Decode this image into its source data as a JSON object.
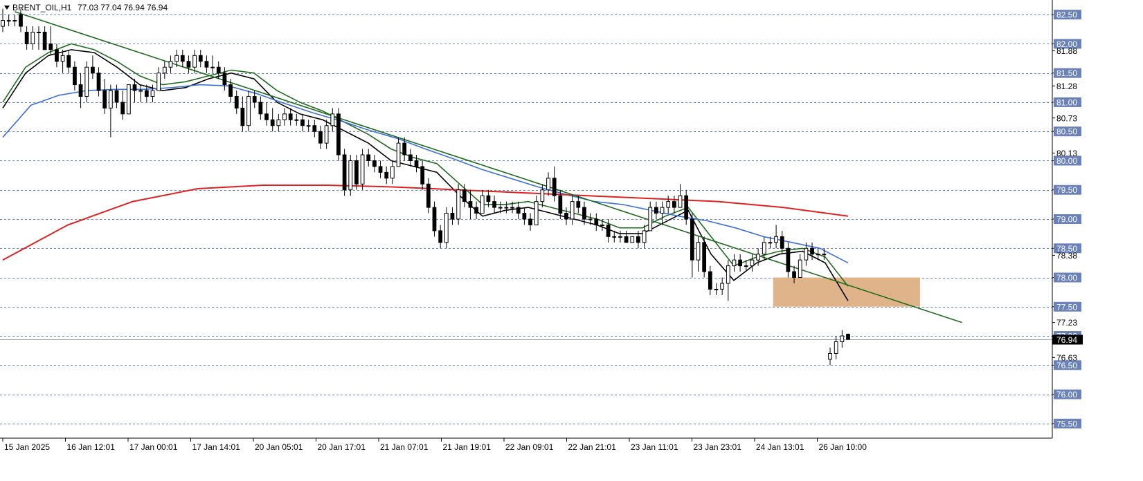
{
  "header": {
    "symbol": "BRENT_OIL,H1",
    "ohlc": "77.03 77.04 76.94 76.94"
  },
  "chart_data": {
    "type": "candlestick",
    "symbol": "BRENT_OIL",
    "timeframe": "H1",
    "ylim": [
      75.25,
      82.75
    ],
    "grid": true,
    "price_labels": [
      "82.50",
      "82.00",
      "81.88",
      "81.50",
      "81.28",
      "81.00",
      "80.73",
      "80.50",
      "80.13",
      "80.00",
      "79.50",
      "79.00",
      "78.50",
      "78.38",
      "78.00",
      "77.50",
      "77.23",
      "77.00",
      "76.63",
      "76.50",
      "76.00",
      "75.50"
    ],
    "highlight_labels": [
      "82.50",
      "82.00",
      "81.50",
      "81.00",
      "80.50",
      "80.00",
      "79.50",
      "79.00",
      "78.50",
      "78.00",
      "77.50",
      "77.00",
      "76.50",
      "76.00",
      "75.50"
    ],
    "current_price": 76.94,
    "current_price_label": "76.94",
    "time_labels": [
      "15 Jan 2025",
      "16 Jan 12:01",
      "17 Jan 00:01",
      "17 Jan 14:01",
      "20 Jan 05:01",
      "20 Jan 17:01",
      "21 Jan 07:01",
      "21 Jan 19:01",
      "22 Jan 09:01",
      "22 Jan 21:01",
      "23 Jan 11:01",
      "23 Jan 23:01",
      "24 Jan 13:01",
      "26 Jan 10:00"
    ],
    "candles": [
      [
        82.3,
        82.6,
        82.2,
        82.4
      ],
      [
        82.4,
        82.5,
        82.3,
        82.4
      ],
      [
        82.4,
        82.5,
        82.3,
        82.4
      ],
      [
        82.5,
        82.6,
        82.2,
        82.3
      ],
      [
        82.2,
        82.3,
        81.9,
        82.0
      ],
      [
        82.0,
        82.3,
        81.9,
        82.2
      ],
      [
        82.2,
        82.3,
        81.9,
        82.2
      ],
      [
        82.2,
        82.3,
        81.9,
        81.9
      ],
      [
        82.0,
        82.3,
        81.8,
        81.9
      ],
      [
        81.9,
        82.0,
        81.6,
        81.7
      ],
      [
        81.7,
        81.9,
        81.5,
        81.8
      ],
      [
        81.8,
        81.9,
        81.5,
        81.6
      ],
      [
        81.6,
        81.7,
        81.2,
        81.3
      ],
      [
        81.3,
        81.5,
        80.9,
        81.1
      ],
      [
        81.1,
        81.7,
        81.0,
        81.6
      ],
      [
        81.6,
        81.8,
        81.4,
        81.5
      ],
      [
        81.5,
        81.6,
        81.1,
        81.2
      ],
      [
        81.2,
        81.4,
        80.8,
        80.9
      ],
      [
        80.9,
        81.3,
        80.4,
        81.2
      ],
      [
        81.2,
        81.3,
        80.9,
        81.0
      ],
      [
        81.0,
        81.2,
        80.7,
        80.8
      ],
      [
        80.8,
        81.3,
        80.8,
        81.3
      ],
      [
        81.3,
        81.4,
        81.0,
        81.2
      ],
      [
        81.2,
        81.3,
        81.0,
        81.2
      ],
      [
        81.2,
        81.3,
        81.0,
        81.1
      ],
      [
        81.1,
        81.3,
        81.0,
        81.2
      ],
      [
        81.2,
        81.6,
        81.2,
        81.5
      ],
      [
        81.5,
        81.7,
        81.4,
        81.6
      ],
      [
        81.6,
        81.8,
        81.5,
        81.7
      ],
      [
        81.7,
        81.9,
        81.6,
        81.8
      ],
      [
        81.8,
        81.9,
        81.6,
        81.7
      ],
      [
        81.7,
        81.8,
        81.5,
        81.6
      ],
      [
        81.6,
        81.9,
        81.5,
        81.8
      ],
      [
        81.8,
        81.9,
        81.6,
        81.7
      ],
      [
        81.7,
        81.8,
        81.5,
        81.6
      ],
      [
        81.6,
        81.8,
        81.5,
        81.6
      ],
      [
        81.6,
        81.7,
        81.4,
        81.5
      ],
      [
        81.5,
        81.6,
        81.2,
        81.3
      ],
      [
        81.3,
        81.4,
        81.0,
        81.1
      ],
      [
        81.1,
        81.2,
        80.8,
        80.9
      ],
      [
        80.9,
        81.1,
        80.5,
        80.6
      ],
      [
        80.6,
        81.2,
        80.5,
        81.1
      ],
      [
        81.1,
        81.2,
        80.9,
        81.0
      ],
      [
        81.0,
        81.1,
        80.7,
        80.8
      ],
      [
        80.8,
        81.0,
        80.6,
        80.7
      ],
      [
        80.7,
        80.9,
        80.5,
        80.6
      ],
      [
        80.6,
        80.8,
        80.5,
        80.7
      ],
      [
        80.7,
        80.9,
        80.6,
        80.8
      ],
      [
        80.8,
        80.9,
        80.6,
        80.7
      ],
      [
        80.7,
        80.8,
        80.6,
        80.7
      ],
      [
        80.7,
        80.8,
        80.5,
        80.6
      ],
      [
        80.6,
        80.7,
        80.5,
        80.6
      ],
      [
        80.6,
        80.7,
        80.4,
        80.5
      ],
      [
        80.5,
        80.6,
        80.2,
        80.3
      ],
      [
        80.3,
        80.7,
        80.2,
        80.6
      ],
      [
        80.6,
        80.9,
        80.5,
        80.8
      ],
      [
        80.8,
        80.9,
        80.0,
        80.1
      ],
      [
        80.1,
        80.2,
        79.4,
        79.5
      ],
      [
        79.5,
        80.1,
        79.4,
        80.0
      ],
      [
        80.0,
        80.1,
        79.5,
        79.6
      ],
      [
        79.6,
        80.2,
        79.5,
        80.1
      ],
      [
        80.1,
        80.2,
        79.9,
        80.0
      ],
      [
        80.0,
        80.1,
        79.8,
        79.9
      ],
      [
        79.9,
        80.0,
        79.7,
        79.8
      ],
      [
        79.8,
        79.9,
        79.6,
        79.7
      ],
      [
        79.7,
        80.0,
        79.6,
        79.9
      ],
      [
        79.9,
        80.4,
        79.9,
        80.3
      ],
      [
        80.3,
        80.4,
        80.0,
        80.1
      ],
      [
        80.1,
        80.2,
        79.9,
        80.0
      ],
      [
        80.0,
        80.1,
        79.8,
        79.9
      ],
      [
        79.9,
        80.0,
        79.5,
        79.6
      ],
      [
        79.6,
        79.7,
        79.1,
        79.2
      ],
      [
        79.2,
        79.3,
        78.7,
        78.8
      ],
      [
        78.8,
        78.9,
        78.5,
        78.6
      ],
      [
        78.6,
        79.2,
        78.5,
        79.1
      ],
      [
        79.1,
        79.2,
        78.9,
        79.0
      ],
      [
        79.0,
        79.6,
        78.9,
        79.5
      ],
      [
        79.5,
        79.6,
        79.2,
        79.3
      ],
      [
        79.3,
        79.5,
        79.0,
        79.2
      ],
      [
        79.2,
        79.3,
        79.0,
        79.1
      ],
      [
        79.1,
        79.5,
        79.1,
        79.4
      ],
      [
        79.4,
        79.5,
        79.2,
        79.3
      ],
      [
        79.3,
        79.4,
        79.1,
        79.2
      ],
      [
        79.2,
        79.3,
        79.1,
        79.2
      ],
      [
        79.2,
        79.3,
        79.1,
        79.2
      ],
      [
        79.2,
        79.3,
        79.1,
        79.2
      ],
      [
        79.2,
        79.3,
        79.0,
        79.1
      ],
      [
        79.1,
        79.2,
        78.9,
        79.0
      ],
      [
        79.0,
        79.1,
        78.8,
        78.9
      ],
      [
        78.9,
        79.4,
        78.9,
        79.3
      ],
      [
        79.3,
        79.6,
        79.2,
        79.5
      ],
      [
        79.5,
        79.8,
        79.4,
        79.7
      ],
      [
        79.7,
        79.9,
        79.3,
        79.4
      ],
      [
        79.4,
        79.5,
        79.0,
        79.1
      ],
      [
        79.1,
        79.2,
        78.9,
        79.0
      ],
      [
        79.0,
        79.4,
        78.9,
        79.3
      ],
      [
        79.3,
        79.4,
        79.1,
        79.2
      ],
      [
        79.2,
        79.3,
        78.9,
        79.0
      ],
      [
        79.0,
        79.1,
        78.9,
        79.0
      ],
      [
        79.0,
        79.1,
        78.8,
        78.9
      ],
      [
        78.9,
        79.0,
        78.8,
        78.9
      ],
      [
        78.9,
        79.0,
        78.6,
        78.7
      ],
      [
        78.7,
        78.8,
        78.6,
        78.7
      ],
      [
        78.7,
        78.8,
        78.6,
        78.7
      ],
      [
        78.7,
        78.8,
        78.6,
        78.6
      ],
      [
        78.6,
        78.7,
        78.6,
        78.7
      ],
      [
        78.7,
        78.8,
        78.5,
        78.6
      ],
      [
        78.6,
        78.9,
        78.5,
        78.8
      ],
      [
        78.8,
        79.3,
        78.8,
        79.2
      ],
      [
        79.2,
        79.3,
        79.0,
        79.1
      ],
      [
        79.1,
        79.3,
        78.9,
        79.2
      ],
      [
        79.2,
        79.4,
        79.1,
        79.3
      ],
      [
        79.3,
        79.4,
        79.1,
        79.2
      ],
      [
        79.2,
        79.6,
        79.2,
        79.4
      ],
      [
        79.4,
        79.5,
        78.9,
        79.0
      ],
      [
        79.0,
        79.1,
        78.0,
        78.3
      ],
      [
        78.3,
        78.7,
        78.1,
        78.6
      ],
      [
        78.6,
        78.7,
        78.0,
        78.1
      ],
      [
        78.1,
        78.2,
        77.7,
        77.8
      ],
      [
        77.8,
        77.9,
        77.7,
        77.8
      ],
      [
        77.8,
        78.0,
        77.7,
        77.9
      ],
      [
        77.9,
        78.3,
        77.6,
        78.2
      ],
      [
        78.2,
        78.4,
        78.1,
        78.3
      ],
      [
        78.3,
        78.4,
        78.1,
        78.2
      ],
      [
        78.2,
        78.3,
        78.1,
        78.2
      ],
      [
        78.2,
        78.4,
        78.1,
        78.3
      ],
      [
        78.3,
        78.5,
        78.2,
        78.4
      ],
      [
        78.4,
        78.7,
        78.3,
        78.6
      ],
      [
        78.6,
        78.7,
        78.5,
        78.6
      ],
      [
        78.6,
        78.9,
        78.5,
        78.7
      ],
      [
        78.7,
        78.8,
        78.4,
        78.5
      ],
      [
        78.5,
        78.6,
        78.0,
        78.1
      ],
      [
        78.1,
        78.2,
        77.9,
        78.0
      ],
      [
        78.0,
        78.4,
        78.0,
        78.3
      ],
      [
        78.3,
        78.6,
        78.2,
        78.5
      ],
      [
        78.5,
        78.6,
        78.3,
        78.4
      ],
      [
        78.4,
        78.5,
        78.3,
        78.4
      ],
      [
        78.4,
        78.5,
        78.3,
        78.4
      ],
      [
        76.6,
        76.8,
        76.5,
        76.7
      ],
      [
        76.7,
        77.0,
        76.6,
        76.9
      ],
      [
        76.9,
        77.1,
        76.8,
        77.0
      ],
      [
        77.03,
        77.04,
        76.94,
        76.94
      ]
    ],
    "moving_averages": [
      {
        "color": "#000000",
        "values": [
          80.9,
          81.5,
          81.8,
          81.9,
          81.85,
          81.6,
          81.3,
          81.2,
          81.25,
          81.4,
          81.5,
          81.4,
          81.0,
          80.8,
          80.7,
          80.5,
          80.3,
          80.0,
          79.9,
          79.8,
          79.4,
          79.05,
          79.15,
          79.2,
          79.1,
          79.0,
          78.9,
          78.75,
          78.75,
          78.95,
          79.15,
          78.4,
          77.95,
          78.25,
          78.4,
          78.45,
          78.25,
          77.6
        ]
      },
      {
        "color": "#1e6b1e",
        "values": [
          81.0,
          81.6,
          81.85,
          82.0,
          81.9,
          81.7,
          81.45,
          81.3,
          81.35,
          81.45,
          81.55,
          81.5,
          81.2,
          81.0,
          80.85,
          80.65,
          80.45,
          80.2,
          80.05,
          79.95,
          79.6,
          79.25,
          79.25,
          79.3,
          79.2,
          79.1,
          79.0,
          78.85,
          78.85,
          79.05,
          79.2,
          78.7,
          78.2,
          78.35,
          78.45,
          78.5,
          78.35,
          77.85
        ]
      },
      {
        "color": "#3a6fe0",
        "values": [
          80.4,
          80.95,
          81.12,
          81.2,
          81.22,
          81.22,
          81.25,
          81.3,
          81.28,
          81.15,
          80.98,
          80.82,
          80.68,
          80.52,
          80.38,
          80.2,
          80.03,
          79.85,
          79.7,
          79.55,
          79.42,
          79.3,
          79.25,
          79.15,
          79.05,
          78.97,
          78.85,
          78.7,
          78.6,
          78.5,
          78.25
        ]
      },
      {
        "color": "#e02020",
        "values": [
          78.3,
          78.9,
          79.3,
          79.52,
          79.58,
          79.58,
          79.55,
          79.5,
          79.45,
          79.4,
          79.35,
          79.3,
          79.2,
          79.05
        ]
      }
    ],
    "trendline": {
      "color": "#1e6b1e",
      "start": [
        2,
        82.55
      ],
      "end": [
        160,
        77.23
      ]
    },
    "zone": {
      "color": "#e0b48a",
      "x_start": 128.5,
      "x_end": 153,
      "y_top": 78.0,
      "y_bottom": 77.5
    }
  }
}
